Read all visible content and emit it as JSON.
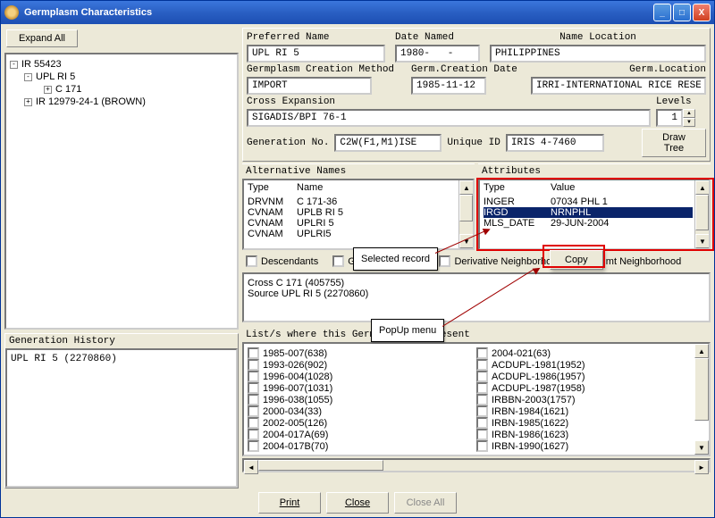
{
  "window": {
    "title": "Germplasm Characteristics"
  },
  "expand_all": "Expand All",
  "tree": {
    "root": "IR 55423",
    "items": [
      {
        "label": "UPL RI 5",
        "toggle": "-"
      },
      {
        "label": "C 171",
        "toggle": "+"
      },
      {
        "label": "IR 12979-24-1 (BROWN)",
        "toggle": "+"
      }
    ]
  },
  "gen_history": {
    "label": "Generation History",
    "value": "UPL RI 5 (2270860)"
  },
  "fields": {
    "pref_name_label": "Preferred Name",
    "pref_name": "UPL RI 5",
    "date_named_label": "Date Named",
    "date_named": "1980-   -",
    "name_loc_label": "Name Location",
    "name_loc": "PHILIPPINES",
    "gcm_label": "Germplasm Creation Method",
    "gcm": "IMPORT",
    "gcd_label": "Germ.Creation Date",
    "gcd": "1985-11-12",
    "gloc_label": "Germ.Location",
    "gloc": "IRRI-INTERNATIONAL RICE RESEARC",
    "cross_exp_label": "Cross Expansion",
    "cross_exp": "SIGADIS/BPI 76-1",
    "levels_label": "Levels",
    "levels": "1",
    "gen_no_label": "Generation No.",
    "gen_no": "C2W(F1,M1)ISE",
    "uid_label": "Unique ID",
    "uid": "IRIS 4-7460",
    "draw_tree": "Draw Tree"
  },
  "alt_names": {
    "title": "Alternative Names",
    "col1": "Type",
    "col2": "Name",
    "rows": [
      {
        "type": "DRVNM",
        "name": "C 171-36"
      },
      {
        "type": "CVNAM",
        "name": "UPLB RI 5"
      },
      {
        "type": "CVNAM",
        "name": "UPLRI 5"
      },
      {
        "type": "CVNAM",
        "name": "UPLRI5"
      }
    ]
  },
  "attributes": {
    "title": "Attributes",
    "col1": "Type",
    "col2": "Value",
    "rows": [
      {
        "type": "INGER",
        "value": "07034 PHL        1"
      },
      {
        "type": "IRGD",
        "value": "NRNPHL",
        "selected": true
      },
      {
        "type": "MLS_DATE",
        "value": "29-JUN-2004"
      }
    ]
  },
  "popup": {
    "copy": "Copy"
  },
  "checks": {
    "descendants": "Descendants",
    "group": "Group Resources",
    "derivative": "Derivative Neighborhood",
    "mgmt": "Mgmt Neighborhood"
  },
  "cross_box": {
    "line1": "Cross  C 171 (405755)",
    "line2": "Source UPL RI 5 (2270860)"
  },
  "lists": {
    "label": "List/s where this Germplasm is present",
    "left": [
      "1985-007(638)",
      "1993-026(902)",
      "1996-004(1028)",
      "1996-007(1031)",
      "1996-038(1055)",
      "2000-034(33)",
      "2002-005(126)",
      "2004-017A(69)",
      "2004-017B(70)"
    ],
    "right": [
      "2004-021(63)",
      "ACDUPL-1981(1952)",
      "ACDUPL-1986(1957)",
      "ACDUPL-1987(1958)",
      "IRBBN-2003(1757)",
      "IRBN-1984(1621)",
      "IRBN-1985(1622)",
      "IRBN-1986(1623)",
      "IRBN-1990(1627)"
    ]
  },
  "footer": {
    "print": "Print",
    "close": "Close",
    "close_all": "Close All"
  },
  "annotations": {
    "selected_record": "Selected record",
    "popup_menu": "PopUp menu"
  }
}
